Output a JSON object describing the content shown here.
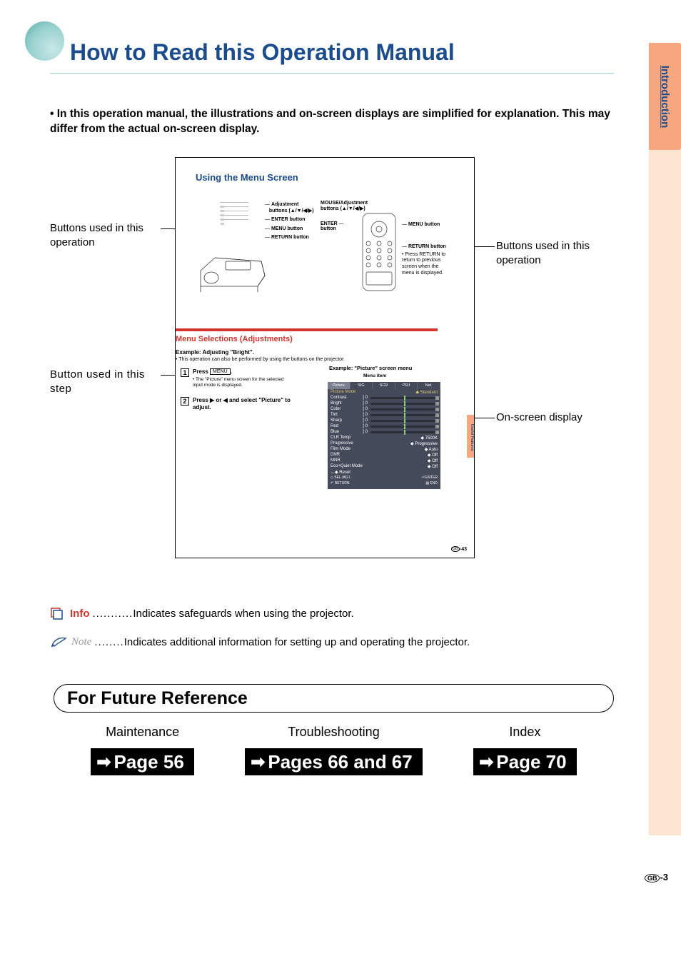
{
  "sideTab": "Introduction",
  "title": "How to Read this Operation Manual",
  "introBullet": "•",
  "intro": "In this operation manual, the illustrations and on-screen displays are simplified for explanation. This may differ from the actual on-screen display.",
  "callouts": {
    "leftTop": "Buttons used in this operation",
    "leftBottom": "Button used in this step",
    "rightTop": "Buttons used in this operation",
    "rightBottom": "On-screen display"
  },
  "samplePage": {
    "title": "Using the Menu Screen",
    "projLabels": {
      "adj": "Adjustment",
      "adjBtns": "buttons (▲/▼/◀/▶)",
      "enter": "ENTER button",
      "menu": "MENU button",
      "ret": "RETURN button"
    },
    "remoteLabels": {
      "mouseAdj": "MOUSE/Adjustment",
      "mouseBtns": "buttons (▲/▼/◀/▶)",
      "enter": "ENTER",
      "enterBtn": "button",
      "menu": "MENU button",
      "ret": "RETURN button",
      "retNote": "• Press RETURN to return to previous screen when the menu is displayed."
    },
    "accentTitle": "Menu Selections (Adjustments)",
    "exampleBold": "Example: Adjusting \"Bright\".",
    "exampleSub": "• This operation can also be performed by using the buttons on the projector.",
    "step1": {
      "num": "1",
      "lead": "Press",
      "btn": "MENU",
      "period": ".",
      "note": "• The \"Picture\" menu screen for the selected input mode is displayed."
    },
    "step2": {
      "num": "2",
      "text": "Press ▶ or ◀ and select \"Picture\" to adjust."
    },
    "exRightTitle": "Example: \"Picture\" screen menu",
    "menuItemLabel": "Menu item",
    "osd": {
      "tabs": [
        "Picture",
        "SIG",
        "SCR",
        "PRJ",
        "Net."
      ],
      "pictureMode": {
        "k": "Picture Mode",
        "v": "Standard"
      },
      "rows": [
        {
          "k": "Contrast",
          "v": "0"
        },
        {
          "k": "Bright",
          "v": "0"
        },
        {
          "k": "Color",
          "v": "0"
        },
        {
          "k": "Tint",
          "v": "0"
        },
        {
          "k": "Sharp",
          "v": "0"
        },
        {
          "k": "Red",
          "v": "0"
        },
        {
          "k": "Blue",
          "v": "0"
        }
      ],
      "opts": [
        {
          "k": "CLR Temp",
          "v": "7500K"
        },
        {
          "k": "Progressive",
          "v": "Progressive"
        },
        {
          "k": "Film Mode",
          "v": "Auto"
        },
        {
          "k": "DNR",
          "v": "Off"
        },
        {
          "k": "MNR",
          "v": "Off"
        },
        {
          "k": "Eco+Quiet Mode",
          "v": "Off"
        }
      ],
      "reset": "Reset",
      "foot": {
        "sel": "SEL./ADJ.",
        "ret": "RETURN",
        "ent": "ENTER",
        "end": "END"
      }
    },
    "sideTab": "Useful Features",
    "pageNum": {
      "gb": "GB",
      "num": "-43"
    }
  },
  "info": {
    "label": "Info",
    "dots": "...........",
    "text": "Indicates safeguards when using the projector."
  },
  "note": {
    "label": "Note",
    "dots": "........",
    "text": "Indicates additional information for setting up and operating the projector."
  },
  "future": {
    "title": "For Future Reference"
  },
  "refs": [
    {
      "head": "Maintenance",
      "btn": "Page 56"
    },
    {
      "head": "Troubleshooting",
      "btn": "Pages 66 and 67"
    },
    {
      "head": "Index",
      "btn": "Page 70"
    }
  ],
  "pageNum": {
    "gb": "GB",
    "num": "-3"
  }
}
